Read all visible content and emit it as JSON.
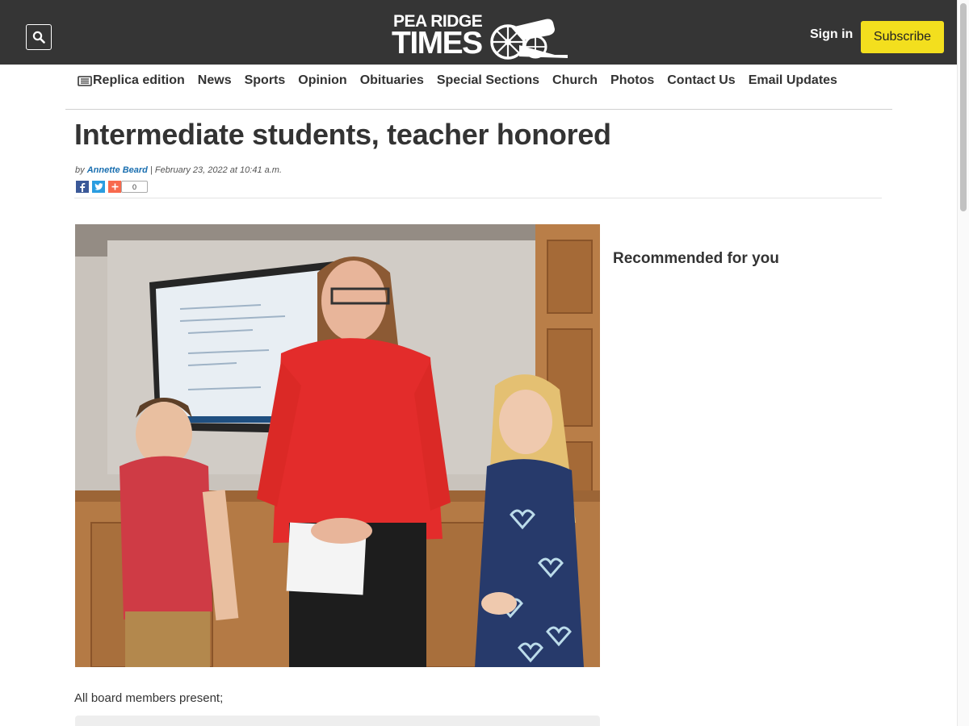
{
  "header": {
    "logo_line1": "PEA RIDGE",
    "logo_line2": "TIMES",
    "signin_label": "Sign in",
    "subscribe_label": "Subscribe"
  },
  "nav": {
    "items": [
      "Replica edition",
      "News",
      "Sports",
      "Opinion",
      "Obituaries",
      "Special Sections",
      "Church",
      "Photos",
      "Contact Us",
      "Email Updates"
    ]
  },
  "article": {
    "headline": "Intermediate students, teacher honored",
    "by": "by",
    "author": "Annette Beard",
    "separator": "|",
    "date": "February 23, 2022 at 10:41 a.m.",
    "share_count": "0",
    "body_first_line": "All board members present;"
  },
  "sidebar": {
    "recommended_title": "Recommended for you"
  },
  "colors": {
    "topbar": "#353535",
    "subscribe": "#f3df1e",
    "author_link": "#1a6fb0",
    "facebook": "#3b5998",
    "twitter": "#2a9de0",
    "addthis": "#f8694d"
  }
}
